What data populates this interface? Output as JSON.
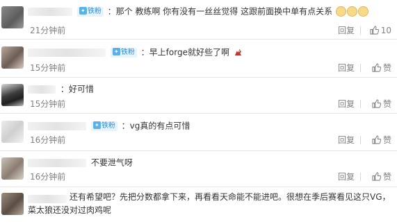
{
  "comments": [
    {
      "badge": "铁粉",
      "text": "：那个 教练啊 你有没有一丝丝觉得 这跟前面换中单有点关系",
      "emoji": "cat-face-emoji",
      "time": "21分钟前",
      "reply_label": "回复",
      "like_label": "10"
    },
    {
      "badge": "铁粉",
      "text": "：早上forge就好些了啊",
      "emoji": "dragon-emoji",
      "time": "15分钟前",
      "reply_label": "回复",
      "like_label": "赞"
    },
    {
      "badge": "",
      "text": "：好可惜",
      "time": "15分钟前",
      "reply_label": "回复",
      "like_label": "赞"
    },
    {
      "badge": "铁粉",
      "text": "：vg真的有点可惜",
      "time": "16分钟前",
      "reply_label": "回复",
      "like_label": "赞"
    },
    {
      "badge": "",
      "text": "不要泄气呀",
      "time": "16分钟前",
      "reply_label": "回复",
      "like_label": "赞"
    },
    {
      "badge": "",
      "text": "还有希望吧？先把分数都拿下来，再看看天命能不能进吧。很想在季后赛看见这只VG，菜太狼还没对过肉鸡呢",
      "time": "",
      "reply_label": "",
      "like_label": ""
    }
  ],
  "colors": {
    "badge_text": "#2b8fd6",
    "meta_text": "#808080",
    "divider": "#e6e6e6"
  }
}
